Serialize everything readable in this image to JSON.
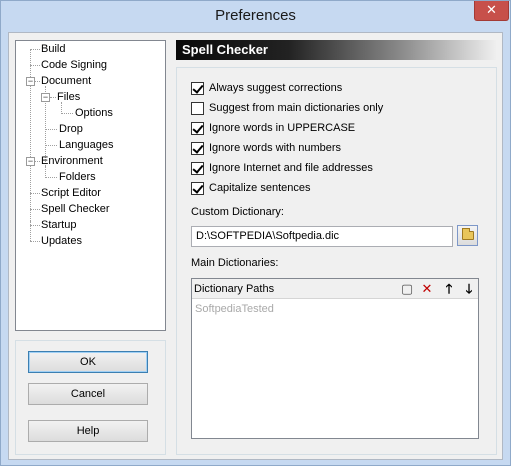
{
  "window": {
    "title": "Preferences",
    "close_glyph": "✕"
  },
  "tree": {
    "items": [
      {
        "label": "Build"
      },
      {
        "label": "Code Signing"
      },
      {
        "label": "Document",
        "toggle": "−"
      },
      {
        "label": "Files",
        "toggle": "−"
      },
      {
        "label": "Options"
      },
      {
        "label": "Drop"
      },
      {
        "label": "Languages"
      },
      {
        "label": "Environment",
        "toggle": "−"
      },
      {
        "label": "Folders"
      },
      {
        "label": "Script Editor"
      },
      {
        "label": "Spell Checker",
        "selected": true
      },
      {
        "label": "Startup"
      },
      {
        "label": "Updates"
      }
    ]
  },
  "buttons": {
    "ok": "OK",
    "cancel": "Cancel",
    "help": "Help"
  },
  "panel": {
    "header": "Spell Checker",
    "options": [
      {
        "label": "Always suggest corrections",
        "checked": true
      },
      {
        "label": "Suggest from main dictionaries only",
        "checked": false
      },
      {
        "label": "Ignore words in UPPERCASE",
        "checked": true
      },
      {
        "label": "Ignore words with numbers",
        "checked": true
      },
      {
        "label": "Ignore Internet and file addresses",
        "checked": true
      },
      {
        "label": "Capitalize sentences",
        "checked": true
      }
    ],
    "custom_dictionary_label": "Custom Dictionary:",
    "custom_dictionary_value": "D:\\SOFTPEDIA\\Softpedia.dic",
    "main_dictionaries_label": "Main Dictionaries:",
    "dictionary_paths_header": "Dictionary Paths",
    "dictionary_paths": [
      "SoftpediaTested"
    ],
    "toolbar": {
      "new": "▢",
      "delete": "✕",
      "up": "🡑",
      "down": "🡓"
    }
  }
}
